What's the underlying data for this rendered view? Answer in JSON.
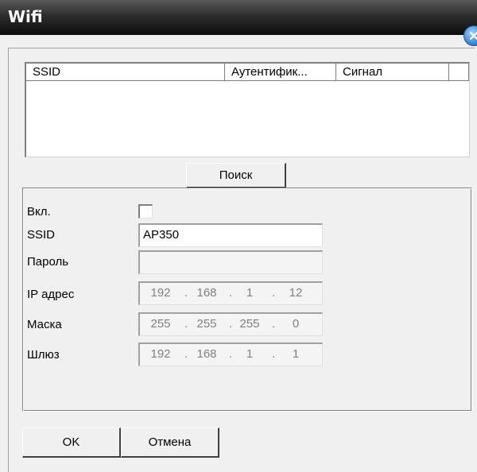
{
  "window": {
    "title": "Wifi"
  },
  "table": {
    "columns": [
      "SSID",
      "Аутентифик...",
      "Сигнал",
      ""
    ],
    "rows": []
  },
  "search_button": "Поиск",
  "settings": {
    "enable_label": "Вкл.",
    "enabled": false,
    "ssid_label": "SSID",
    "ssid_value": "AP350",
    "password_label": "Пароль",
    "password_value": "",
    "ip_label": "IP адрес",
    "ip": [
      "192",
      "168",
      "1",
      "12"
    ],
    "mask_label": "Маска",
    "mask": [
      "255",
      "255",
      "255",
      "0"
    ],
    "gateway_label": "Шлюз",
    "gateway": [
      "192",
      "168",
      "1",
      "1"
    ]
  },
  "ok_button": "OK",
  "cancel_button": "Отмена",
  "ip_separator": "."
}
